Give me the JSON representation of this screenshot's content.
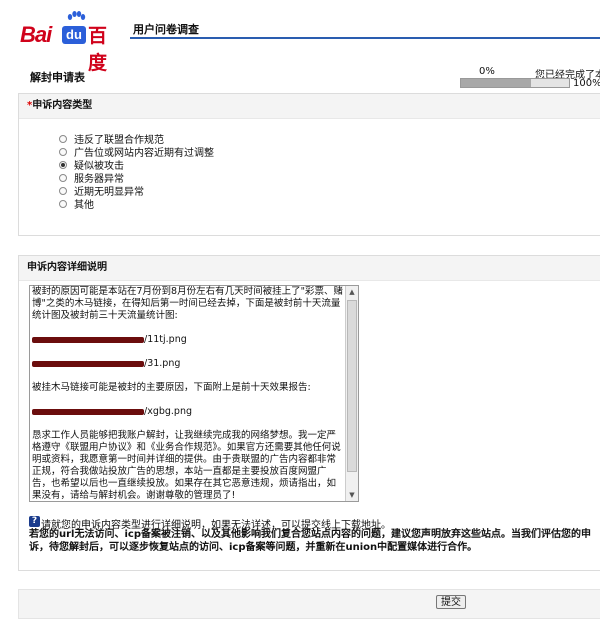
{
  "brand": {
    "logo_latin_1": "Bai",
    "logo_latin_2": "du",
    "logo_cn": "百度",
    "brand_color": "#d0021b",
    "du_color": "#2b5fd9"
  },
  "header": {
    "title": "用户问卷调查",
    "accent": "#2a5db0"
  },
  "form": {
    "title": "解封申请表"
  },
  "progress": {
    "start_label": "0%",
    "status_text": "您已经完成了本",
    "end_label": "100%",
    "fraction": 0.65
  },
  "complaint_type": {
    "required_mark": "*",
    "heading": "申诉内容类型",
    "options": [
      {
        "label": "违反了联盟合作规范",
        "checked": false
      },
      {
        "label": "广告位或网站内容近期有过调整",
        "checked": false
      },
      {
        "label": "疑似被攻击",
        "checked": true
      },
      {
        "label": "服务器异常",
        "checked": false
      },
      {
        "label": "近期无明显异常",
        "checked": false
      },
      {
        "label": "其他",
        "checked": false
      }
    ]
  },
  "details": {
    "heading": "申诉内容详细说明",
    "para1": "被封的原因可能是本站在7月份到8月份左右有几天时间被挂上了\"彩票、赌博\"之类的木马链接，在得知后第一时间已经去掉，下面是被封前十天流量统计图及被封前三十天流量统计图:",
    "url1_suffix": "/11tj.png",
    "url2_suffix": "/31.png",
    "para2": "被挂木马链接可能是被封的主要原因，下面附上是前十天效果报告:",
    "url3_suffix": "/xgbg.png",
    "para3": "恳求工作人员能够把我账户解封，让我继续完成我的网络梦想。我一定严格遵守《联盟用户协议》和《业务合作规范》。如果官方还需要其他任何说明或资料，我愿意第一时间并详细的提供。由于贵联盟的广告内容都非常正规，符合我做站投放广告的思想，本站一直都是主要投放百度网盟广告，也希望以后也一直继续投放。如果存在其它恶意违规，烦请指出，如果没有，请给与解封机会。谢谢尊敬的管理员了!"
  },
  "help": {
    "icon_glyph": "?",
    "text": "请就您的申诉内容类型进行详细说明，如果无法详述，可以提交线上下载地址。",
    "notice": "若您的url无法访问、icp备案被注销、以及其他影响我们复合您站点内容的问题，建议您声明放弃这些站点。当我们评估您的申诉，待您解封后，可以逐步恢复站点的访问、icp备案等问题，并重新在union中配置媒体进行合作。"
  },
  "submit": {
    "label": "提交"
  }
}
